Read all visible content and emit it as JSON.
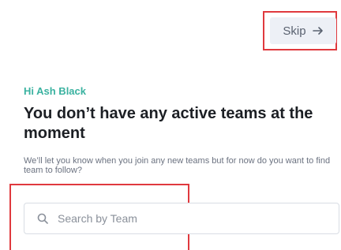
{
  "header": {
    "skip_label": "Skip",
    "skip_icon": "arrow-right-icon"
  },
  "main": {
    "greeting": "Hi Ash Black",
    "heading": "You don’t have any active teams at the moment",
    "subtext": "We’ll let you know when you join any new teams but for now do you want to find team to follow?"
  },
  "search": {
    "placeholder": "Search by Team",
    "value": "",
    "icon": "search-icon"
  },
  "colors": {
    "accent": "#3ab2a0",
    "annotation_outline": "#e0393e",
    "skip_background": "#edf0f6"
  }
}
